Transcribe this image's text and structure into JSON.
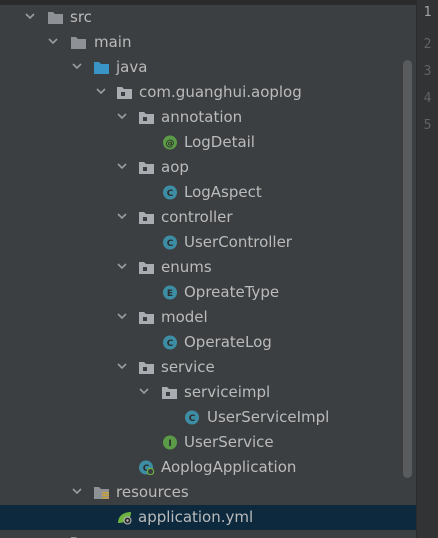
{
  "project_tree": [
    {
      "label": "src",
      "icon": "folder-icon",
      "expanded": true
    },
    {
      "label": "main",
      "icon": "folder-icon",
      "expanded": true
    },
    {
      "label": "java",
      "icon": "source-root-folder-icon",
      "expanded": true
    },
    {
      "label": "com.guanghui.aoplog",
      "icon": "package-icon",
      "expanded": true
    },
    {
      "label": "annotation",
      "icon": "package-icon",
      "expanded": true
    },
    {
      "label": "LogDetail",
      "icon": "annotation-icon",
      "badge": "@"
    },
    {
      "label": "aop",
      "icon": "package-icon",
      "expanded": true
    },
    {
      "label": "LogAspect",
      "icon": "class-icon",
      "badge": "C"
    },
    {
      "label": "controller",
      "icon": "package-icon",
      "expanded": true
    },
    {
      "label": "UserController",
      "icon": "class-icon",
      "badge": "C"
    },
    {
      "label": "enums",
      "icon": "package-icon",
      "expanded": true
    },
    {
      "label": "OpreateType",
      "icon": "enum-icon",
      "badge": "E"
    },
    {
      "label": "model",
      "icon": "package-icon",
      "expanded": true
    },
    {
      "label": "OperateLog",
      "icon": "class-icon",
      "badge": "C"
    },
    {
      "label": "service",
      "icon": "package-icon",
      "expanded": true
    },
    {
      "label": "serviceimpl",
      "icon": "package-icon",
      "expanded": true
    },
    {
      "label": "UserServiceImpl",
      "icon": "class-icon",
      "badge": "C"
    },
    {
      "label": "UserService",
      "icon": "interface-icon",
      "badge": "I"
    },
    {
      "label": "AoplogApplication",
      "icon": "spring-boot-class-icon",
      "badge": "C"
    },
    {
      "label": "resources",
      "icon": "resources-folder-icon",
      "expanded": true
    },
    {
      "label": "application.yml",
      "icon": "spring-config-file-icon",
      "selected": true
    }
  ],
  "gutter_lines": [
    "1",
    "2",
    "3",
    "4",
    "5"
  ],
  "colors": {
    "tree_background": "#3c3f41",
    "selected_row": "#0d293e",
    "folder": "#8e9296",
    "source_root": "#3a95c7",
    "package": "#a9adb1",
    "class_badge": "#3d8ea5",
    "annotation_badge": "#5b9b47",
    "enum_badge": "#3d8ea5",
    "interface_badge": "#5b9b47",
    "spring_leaf": "#6db33f"
  }
}
